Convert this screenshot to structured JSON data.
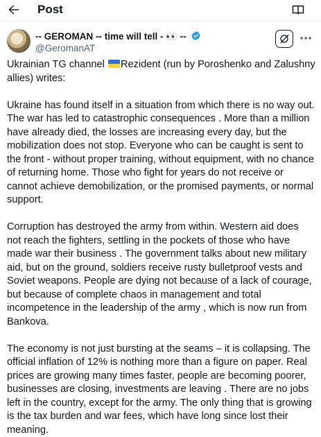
{
  "header": {
    "back_icon": "arrow-left-icon",
    "title": "Post",
    "reader_icon": "reader-mode-icon"
  },
  "post": {
    "author": {
      "display_name": "-- GEROMAN -- time will tell - 👀 --",
      "handle": "@GeromanAT",
      "verified": true,
      "verified_color": "#1d9bf0"
    },
    "actions": {
      "grok_icon": "grok-icon",
      "more_icon": "more-horizontal-icon"
    },
    "intro_before_flag": "Ukrainian TG channel ",
    "flag_icon": "ukraine-flag-icon",
    "intro_after_flag": "Rezident (run by Poroshenko and Zalushny allies) writes:",
    "paragraphs": [
      "Ukraine has found itself in a situation from which there is no way out. The war has led to catastrophic consequences . More than a million have already died, the losses are increasing every day, but the mobilization does not stop. Everyone who can be caught is sent to the front - without proper training, without equipment, with no chance of returning home. Those who fight for years do not receive or cannot achieve demobilization, or the promised payments, or normal support.",
      "Corruption has destroyed the army from within. Western aid does not reach the fighters, settling in the pockets of those who have made war their business . The government talks about new military aid, but on the ground, soldiers receive rusty bulletproof vests and Soviet weapons. People are dying not because of a lack of courage, but because of complete chaos in management and total incompetence in the leadership of the army , which is now run from Bankova.",
      "The economy is not just bursting at the seams – it is collapsing. The official inflation of 12% is nothing more than a figure on paper. Real prices are growing many times faster, people are becoming poorer, businesses are closing, investments are leaving . There are no jobs left in the country, except for the army. The only thing that is growing is the tax burden and war fees, which have long since lost their meaning."
    ]
  }
}
